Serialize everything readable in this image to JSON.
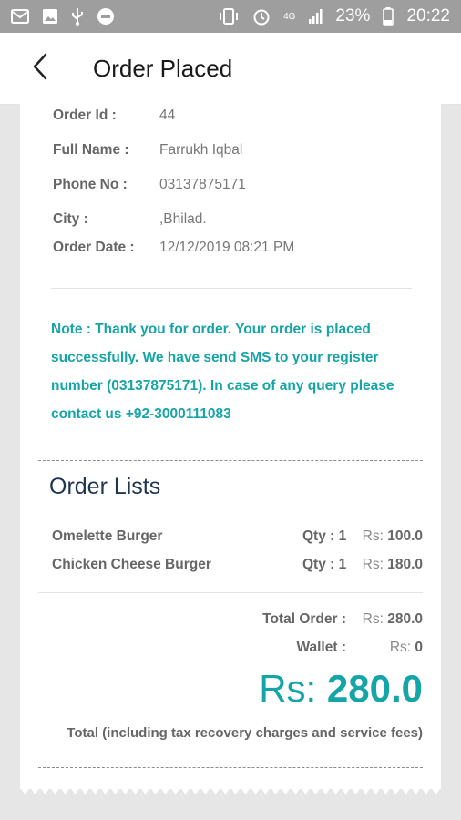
{
  "status_bar": {
    "battery": "23%",
    "time": "20:22",
    "network": "4G",
    "icons_left": [
      "gmail-icon",
      "gallery-icon",
      "usb-icon",
      "circle-app-icon"
    ],
    "icons_right": [
      "vibrate-icon",
      "alarm-icon",
      "network-4g-icon",
      "signal-icon",
      "battery-icon"
    ]
  },
  "app_bar": {
    "title": "Order Placed",
    "back_icon": "back-arrow-icon"
  },
  "order_info": {
    "order_id": {
      "label": "Order Id :",
      "value": "44"
    },
    "full_name": {
      "label": "Full Name :",
      "value": "Farrukh Iqbal"
    },
    "phone": {
      "label": "Phone No :",
      "value": "03137875171"
    },
    "city": {
      "label": "City :",
      "value": ",Bhilad."
    },
    "order_date": {
      "label": "Order Date :",
      "value": "12/12/2019 08:21 PM"
    }
  },
  "note": "Note : Thank you for order. Your order is placed successfully. We have send SMS to your register number (03137875171). In case of any query please contact us +92-3000111083",
  "order_list": {
    "title": "Order Lists",
    "items": [
      {
        "name": "Omelette Burger",
        "qty": "Qty : 1",
        "currency": "Rs:",
        "price": "100.0"
      },
      {
        "name": "Chicken Cheese Burger",
        "qty": "Qty : 1",
        "currency": "Rs:",
        "price": "180.0"
      }
    ]
  },
  "summary": {
    "total_order": {
      "label": "Total Order :",
      "currency": "Rs:",
      "value": "280.0"
    },
    "wallet": {
      "label": "Wallet :",
      "currency": "Rs:",
      "value": "0"
    },
    "grand_total": {
      "currency": "Rs:",
      "value": "280.0"
    },
    "footnote": "Total (including tax recovery charges and service fees)"
  },
  "colors": {
    "accent": "#15a5a8",
    "heading": "#1f3550",
    "status_bar": "#9e9e9e"
  }
}
